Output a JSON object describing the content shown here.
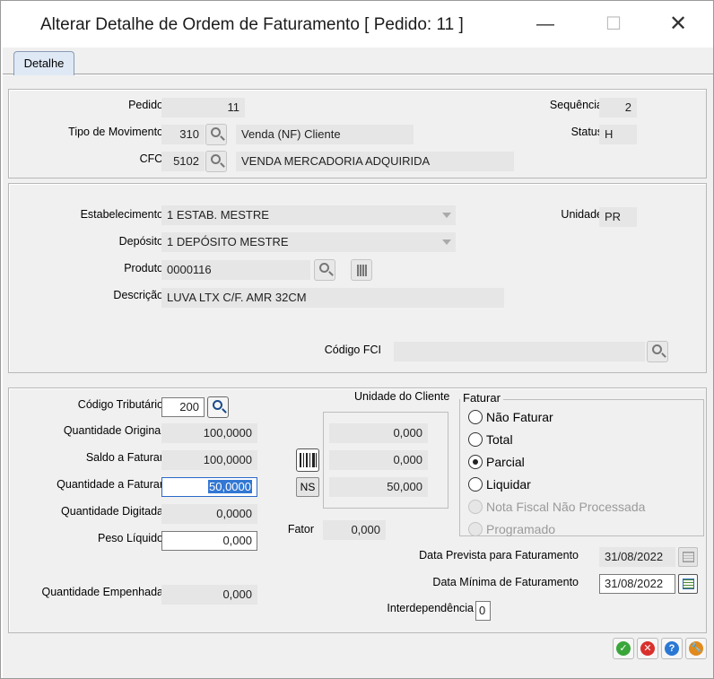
{
  "window": {
    "title": "Alterar Detalhe de Ordem de Faturamento [ Pedido: 11 ]",
    "minimize": "—",
    "maximize": "☐",
    "close": "✕"
  },
  "tabs": [
    {
      "label": "Detalhe",
      "active": true
    }
  ],
  "header": {
    "pedido_label": "Pedido",
    "pedido_value": "11",
    "sequencia_label": "Sequência",
    "sequencia_value": "2",
    "tipo_mov_label": "Tipo de Movimento",
    "tipo_mov_code": "310",
    "tipo_mov_desc": "Venda (NF) Cliente",
    "status_label": "Status",
    "status_value": "H",
    "cfo_label": "CFO",
    "cfo_code": "5102",
    "cfo_desc": "VENDA MERCADORIA ADQUIRIDA"
  },
  "product": {
    "estab_label": "Estabelecimento",
    "estab_value": "1 ESTAB. MESTRE",
    "unidade_label": "Unidade",
    "unidade_value": "PR",
    "deposito_label": "Depósito",
    "deposito_value": "1 DEPÓSITO MESTRE",
    "produto_label": "Produto",
    "produto_value": "0000116",
    "descricao_label": "Descrição",
    "descricao_value": "LUVA LTX C/F. AMR 32CM",
    "fci_label": "Código FCI",
    "fci_value": ""
  },
  "quantities": {
    "cod_trib_label": "Código Tributário",
    "cod_trib_value": "200",
    "qtd_original_label": "Quantidade Original",
    "qtd_original_value": "100,0000",
    "saldo_label": "Saldo a Faturar",
    "saldo_value": "100,0000",
    "qtd_faturar_label": "Quantidade a Faturar",
    "qtd_faturar_value": "50,0000",
    "qtd_digitada_label": "Quantidade Digitada",
    "qtd_digitada_value": "0,0000",
    "peso_label": "Peso Líquido",
    "peso_value": "0,000",
    "qtd_empenhada_label": "Quantidade Empenhada",
    "qtd_empenhada_value": "0,000"
  },
  "unidade_cliente": {
    "label": "Unidade do Cliente",
    "values": [
      "0,000",
      "0,000",
      "50,000"
    ],
    "ns_label": "NS",
    "fator_label": "Fator",
    "fator_value": "0,000"
  },
  "faturar": {
    "label": "Faturar",
    "options": [
      {
        "label": "Não Faturar",
        "checked": false,
        "disabled": false
      },
      {
        "label": "Total",
        "checked": false,
        "disabled": false
      },
      {
        "label": "Parcial",
        "checked": true,
        "disabled": false
      },
      {
        "label": "Liquidar",
        "checked": false,
        "disabled": false
      },
      {
        "label": "Nota Fiscal Não Processada",
        "checked": false,
        "disabled": true
      },
      {
        "label": "Programado",
        "checked": false,
        "disabled": true
      }
    ]
  },
  "dates": {
    "prevista_label": "Data Prevista para Faturamento",
    "prevista_value": "31/08/2022",
    "minima_label": "Data Mínima de Faturamento",
    "minima_value": "31/08/2022",
    "interdep_label": "Interdependência",
    "interdep_value": "0"
  },
  "actions": {
    "ok": "✓",
    "cancel": "✕",
    "help": "?",
    "config": "🔧"
  },
  "colors": {
    "ok": "#3aa63a",
    "cancel": "#d9302c",
    "help": "#2b78d4",
    "config": "#e08a1e"
  }
}
